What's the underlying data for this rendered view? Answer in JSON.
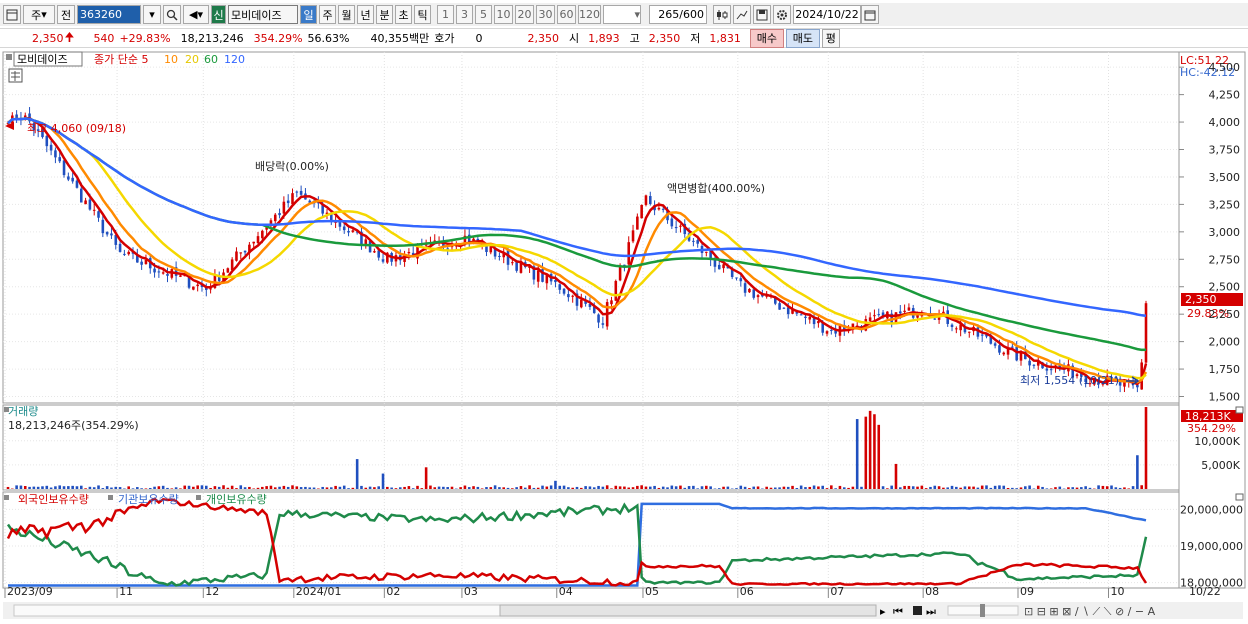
{
  "toolbar": {
    "market_select": "주",
    "prefix_button": "전",
    "stock_code": "363260",
    "stock_name": "모비데이즈",
    "new_badge": "신",
    "periods": [
      "일",
      "주",
      "월",
      "년",
      "분",
      "초",
      "틱"
    ],
    "intervals": [
      "1",
      "3",
      "5",
      "10",
      "20",
      "30",
      "60",
      "120"
    ],
    "count": "265",
    "count_total": "/600",
    "date": "2024/10/22",
    "icons": [
      "window-icon",
      "search-icon",
      "speaker-icon",
      "candle-icon",
      "crosshair-icon",
      "save-icon",
      "gear-icon",
      "calendar-icon"
    ]
  },
  "quote": {
    "price": "2,350",
    "arrow": "🠉",
    "change": "540",
    "change_pct": "+29.83%",
    "volume": "18,213,246",
    "volume_pct": "354.29%",
    "turnover_pct": "56.63%",
    "amount": "40,355백만",
    "bid_label": "호가",
    "bid_value": "0",
    "bid_price": "2,350",
    "open_label": "시",
    "open": "1,893",
    "high_label": "고",
    "high": "2,350",
    "low_label": "저",
    "low": "1,831",
    "buy_button": "매수",
    "sell_button": "매도",
    "eval_button": "평"
  },
  "price_panel": {
    "legend_name": "모비데이즈",
    "legend_items": [
      "종가 단순 5",
      "10",
      "20",
      "60",
      "120"
    ],
    "legend_colors": [
      "#d40000",
      "#ff8a00",
      "#f5d800",
      "#1a9a3c",
      "#3366ff"
    ],
    "lc": "LC:51.22",
    "hc": "HC:-42.12",
    "y_ticks": [
      "4,500",
      "4,250",
      "4,000",
      "3,750",
      "3,500",
      "3,250",
      "3,000",
      "2,750",
      "2,500",
      "2,250",
      "2,000",
      "1,750",
      "1,500"
    ],
    "high_annotation": "최고 4,060 (09/18)",
    "low_annotation": "최저 1,554 (10/21)",
    "dividend_annotation": "배당락(0.00%)",
    "split_annotation": "액면병합(400.00%)",
    "last_price_tag": "2,350",
    "last_pct_tag": "29.83%"
  },
  "volume_panel": {
    "title": "거래량",
    "value": "18,213,246주(354.29%)",
    "y_ticks": [
      "10,000K",
      "5,000K"
    ],
    "last_tag": "18,213K",
    "last_pct": "354.29%"
  },
  "holdings_panel": {
    "legend": [
      "외국인보유수량",
      "기관보유수량",
      "개인보유수량"
    ],
    "legend_colors": [
      "#d40000",
      "#3366cc",
      "#1a8a4a"
    ],
    "y_ticks": [
      "20,000,000",
      "19,000,000",
      "18,000,000"
    ]
  },
  "x_axis": {
    "labels": [
      "2023/09",
      "11",
      "12",
      "2024/01",
      "02",
      "03",
      "04",
      "05",
      "06",
      "07",
      "08",
      "09",
      "10",
      "10/22"
    ]
  },
  "chart_data": {
    "type": "candlestick",
    "title": "모비데이즈",
    "ylim": [
      1450,
      4620
    ],
    "sma_periods": [
      5,
      10,
      20,
      60,
      120
    ],
    "close_keypoints": [
      [
        "2023/09",
        4050
      ],
      [
        "2023/09/18",
        4060
      ],
      [
        "2023/10",
        3150
      ],
      [
        "2023/11",
        2800
      ],
      [
        "2023/12",
        2480
      ],
      [
        "2024/01",
        3350
      ],
      [
        "2024/02",
        2750
      ],
      [
        "2024/03",
        2950
      ],
      [
        "2024/04",
        2500
      ],
      [
        "2024/04 end",
        2200
      ],
      [
        "2024/05",
        3300
      ],
      [
        "2024/06",
        2500
      ],
      [
        "2024/07",
        2100
      ],
      [
        "2024/08",
        2300
      ],
      [
        "2024/09",
        1850
      ],
      [
        "2024/10/21",
        1554
      ],
      [
        "2024/10/22",
        2350
      ]
    ],
    "volume_ylim": [
      0,
      17000000
    ],
    "last_volume": 18213246,
    "holdings_series": [
      {
        "name": "외국인보유수량",
        "range": [
          17900000,
          20300000
        ]
      },
      {
        "name": "기관보유수량",
        "range": [
          17950000,
          20150000
        ]
      },
      {
        "name": "개인보유수량",
        "range": [
          17900000,
          20200000
        ]
      }
    ]
  }
}
